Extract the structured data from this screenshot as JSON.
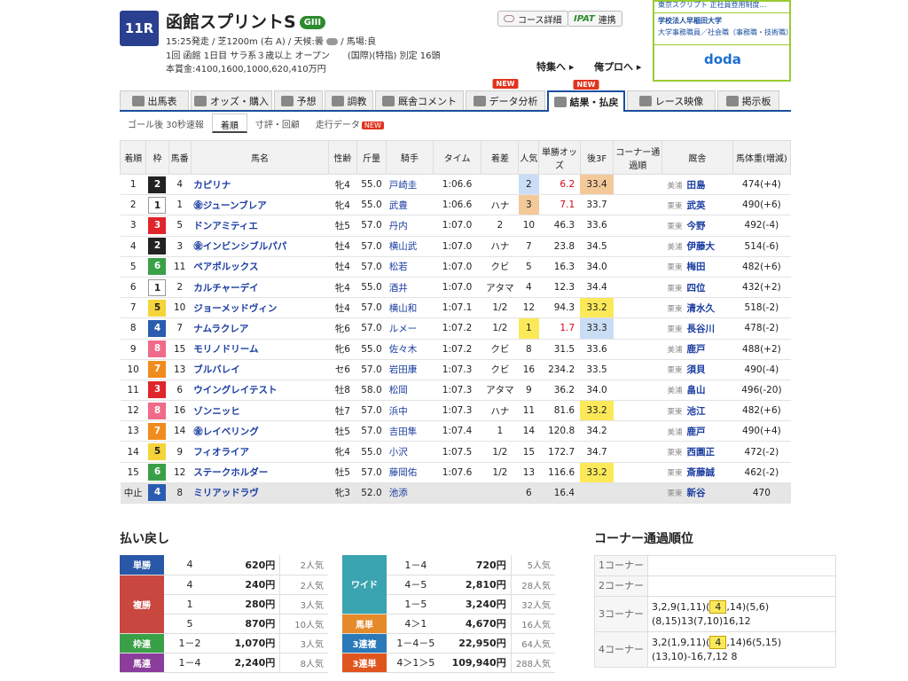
{
  "race": {
    "number": "11R",
    "name": "函館スプリントS",
    "grade": "GIII",
    "line1": "15:25発走 / 芝1200m (右 A) / 天候:曇",
    "line1b": "/ 馬場:良",
    "line2": "1回 函館 1日目 サラ系３歳以上 オープン　　(国際)(特指) 別定 16頭",
    "line3": "本賞金:4100,1600,1000,620,410万円"
  },
  "buttons": {
    "course": "コース詳細",
    "ipat": "IPAT",
    "ipat_sub": "連携"
  },
  "links": {
    "special": "特集へ ▸",
    "pro": "俺プロへ ▸"
  },
  "ad": {
    "l1": "学校法人早稲田大学",
    "l2": "大学事務職員／社会職（事務職・技術職）",
    "l3": "doda",
    "top": "東京スクリプト 正社員登用制度…"
  },
  "tabs": [
    {
      "label": "出馬表",
      "new": ""
    },
    {
      "label": "オッズ・購入",
      "new": ""
    },
    {
      "label": "予想",
      "new": ""
    },
    {
      "label": "調教",
      "new": ""
    },
    {
      "label": "厩舎コメント",
      "new": ""
    },
    {
      "label": "データ分析",
      "new": "NEW"
    },
    {
      "label": "結果・払戻",
      "new": "NEW"
    },
    {
      "label": "レース映像",
      "new": ""
    },
    {
      "label": "掲示板",
      "new": ""
    }
  ],
  "subtabs": [
    "ゴール後 30秒速報",
    "着順",
    "寸評・回顧",
    "走行データ"
  ],
  "subtab_new": "NEW",
  "headers": [
    "着順",
    "枠",
    "馬番",
    "馬名",
    "性齢",
    "斤量",
    "騎手",
    "タイム",
    "着差",
    "人気",
    "単勝オッズ",
    "後3F",
    "コーナー通過順",
    "厩舎",
    "馬体重(増減)"
  ],
  "rows": [
    [
      "1",
      "2",
      "4",
      "カピリナ",
      "牝4",
      "55.0",
      "戸崎圭",
      "1:06.6",
      "",
      "2",
      "6.2",
      "33.4",
      "",
      "美浦",
      "田島",
      "474(+4)"
    ],
    [
      "2",
      "1",
      "1",
      "㊎ジューンブレア",
      "牝4",
      "55.0",
      "武豊",
      "1:06.6",
      "ハナ",
      "3",
      "7.1",
      "33.7",
      "",
      "栗東",
      "武英",
      "490(+6)"
    ],
    [
      "3",
      "3",
      "5",
      "ドンアミティエ",
      "牡5",
      "57.0",
      "丹内",
      "1:07.0",
      "2",
      "10",
      "46.3",
      "33.6",
      "",
      "栗東",
      "今野",
      "492(-4)"
    ],
    [
      "4",
      "2",
      "3",
      "㊎インビンシブルパパ",
      "牡4",
      "57.0",
      "横山武",
      "1:07.0",
      "ハナ",
      "7",
      "23.8",
      "34.5",
      "",
      "美浦",
      "伊藤大",
      "514(-6)"
    ],
    [
      "5",
      "6",
      "11",
      "ペアポルックス",
      "牡4",
      "57.0",
      "松若",
      "1:07.0",
      "クビ",
      "5",
      "16.3",
      "34.0",
      "",
      "栗東",
      "梅田",
      "482(+6)"
    ],
    [
      "6",
      "1",
      "2",
      "カルチャーデイ",
      "牝4",
      "55.0",
      "酒井",
      "1:07.0",
      "アタマ",
      "4",
      "12.3",
      "34.4",
      "",
      "栗東",
      "四位",
      "432(+2)"
    ],
    [
      "7",
      "5",
      "10",
      "ジョーメッドヴィン",
      "牡4",
      "57.0",
      "横山和",
      "1:07.1",
      "1/2",
      "12",
      "94.3",
      "33.2",
      "",
      "栗東",
      "清水久",
      "518(-2)"
    ],
    [
      "8",
      "4",
      "7",
      "ナムラクレア",
      "牝6",
      "57.0",
      "ルメー",
      "1:07.2",
      "1/2",
      "1",
      "1.7",
      "33.3",
      "",
      "栗東",
      "長谷川",
      "478(-2)"
    ],
    [
      "9",
      "8",
      "15",
      "モリノドリーム",
      "牝6",
      "55.0",
      "佐々木",
      "1:07.2",
      "クビ",
      "8",
      "31.5",
      "33.6",
      "",
      "美浦",
      "鹿戸",
      "488(+2)"
    ],
    [
      "10",
      "7",
      "13",
      "ブルバレイ",
      "セ6",
      "57.0",
      "岩田康",
      "1:07.3",
      "クビ",
      "16",
      "234.2",
      "33.5",
      "",
      "栗東",
      "須貝",
      "490(-4)"
    ],
    [
      "11",
      "3",
      "6",
      "ウイングレイテスト",
      "牡8",
      "58.0",
      "松岡",
      "1:07.3",
      "アタマ",
      "9",
      "36.2",
      "34.0",
      "",
      "美浦",
      "畠山",
      "496(-20)"
    ],
    [
      "12",
      "8",
      "16",
      "ゾンニッヒ",
      "牡7",
      "57.0",
      "浜中",
      "1:07.3",
      "ハナ",
      "11",
      "81.6",
      "33.2",
      "",
      "栗東",
      "池江",
      "482(+6)"
    ],
    [
      "13",
      "7",
      "14",
      "㊎レイベリング",
      "牡5",
      "57.0",
      "吉田隼",
      "1:07.4",
      "1",
      "14",
      "120.8",
      "34.2",
      "",
      "美浦",
      "鹿戸",
      "490(+4)"
    ],
    [
      "14",
      "5",
      "9",
      "フィオライア",
      "牝4",
      "55.0",
      "小沢",
      "1:07.5",
      "1/2",
      "15",
      "172.7",
      "34.7",
      "",
      "栗東",
      "西園正",
      "472(-2)"
    ],
    [
      "15",
      "6",
      "12",
      "ステークホルダー",
      "牡5",
      "57.0",
      "藤岡佑",
      "1:07.6",
      "1/2",
      "13",
      "116.6",
      "33.2",
      "",
      "栗東",
      "斎藤誠",
      "462(-2)"
    ],
    [
      "中止",
      "4",
      "8",
      "ミリアッドラヴ",
      "牝3",
      "52.0",
      "池添",
      "",
      "",
      "6",
      "16.4",
      "",
      "",
      "栗東",
      "新谷",
      "470"
    ]
  ],
  "payout": {
    "title": "払い戻し",
    "left": [
      {
        "type": "単勝",
        "color": "#2a58a8",
        "items": [
          [
            "4",
            "620円",
            "2人気"
          ]
        ]
      },
      {
        "type": "複勝",
        "color": "#c8473f",
        "items": [
          [
            "4",
            "240円",
            "2人気"
          ],
          [
            "1",
            "280円",
            "3人気"
          ],
          [
            "5",
            "870円",
            "10人気"
          ]
        ]
      },
      {
        "type": "枠連",
        "color": "#3aa048",
        "items": [
          [
            "1－2",
            "1,070円",
            "3人気"
          ]
        ]
      },
      {
        "type": "馬連",
        "color": "#8a3d9a",
        "items": [
          [
            "1－4",
            "2,240円",
            "8人気"
          ]
        ]
      }
    ],
    "right": [
      {
        "type": "ワイド",
        "color": "#3aa3b0",
        "items": [
          [
            "1－4",
            "720円",
            "5人気"
          ],
          [
            "4－5",
            "2,810円",
            "28人気"
          ],
          [
            "1－5",
            "3,240円",
            "32人気"
          ]
        ]
      },
      {
        "type": "馬単",
        "color": "#e58a2a",
        "items": [
          [
            "4＞1",
            "4,670円",
            "16人気"
          ]
        ]
      },
      {
        "type": "3連複",
        "color": "#2a79b8",
        "items": [
          [
            "1－4－5",
            "22,950円",
            "64人気"
          ]
        ]
      },
      {
        "type": "3連単",
        "color": "#e0551f",
        "items": [
          [
            "4＞1＞5",
            "109,940円",
            "288人気"
          ]
        ]
      }
    ]
  },
  "corner": {
    "title": "コーナー通過順位",
    "rows": [
      {
        "label": "1コーナー",
        "text": ""
      },
      {
        "label": "2コーナー",
        "text": ""
      },
      {
        "label": "3コーナー",
        "text": "3,2,9(1,11)(4,14)(5,6)(8,15)13(7,10)16,12"
      },
      {
        "label": "4コーナー",
        "text": "3,2(1,9,11)(4,14)6(5,15)(13,10)-16,7,12 8"
      }
    ]
  },
  "colors": {
    "waku": {
      "1": "#ffffff",
      "2": "#222222",
      "3": "#e0252b",
      "4": "#2a5db0",
      "5": "#f5d43a",
      "6": "#3aa048",
      "7": "#f08c1e",
      "8": "#f06a8a"
    }
  }
}
